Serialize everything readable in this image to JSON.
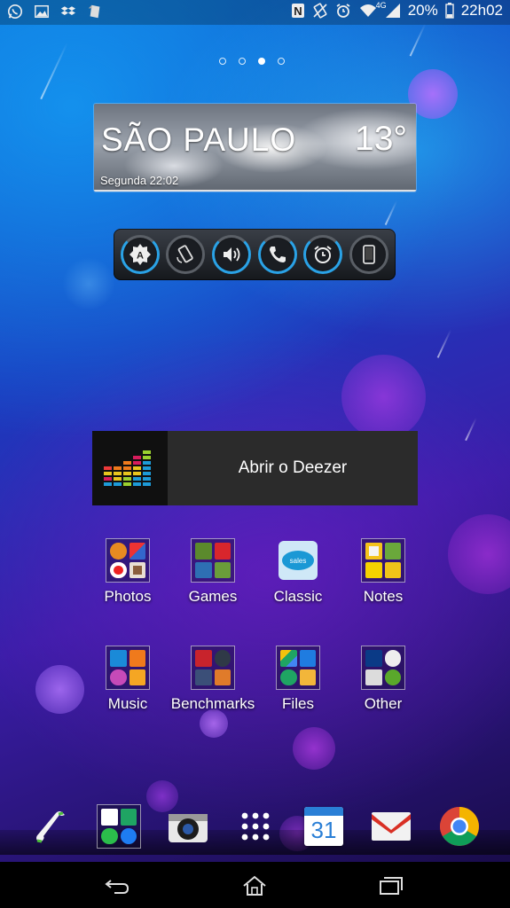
{
  "status_bar": {
    "left_icons": [
      "whatsapp-icon",
      "image-icon",
      "dropbox-icon",
      "evernote-icon"
    ],
    "right_icons": [
      "nfc-icon",
      "vibrate-icon",
      "alarm-icon",
      "wifi-icon",
      "signal-icon",
      "battery-icon"
    ],
    "network_type": "4G",
    "battery_percent": "20%",
    "time": "22h02"
  },
  "home": {
    "pages": 4,
    "active_page": 3
  },
  "weather": {
    "city": "SÃO PAULO",
    "temperature": "13°",
    "datetime": "Segunda 22:02"
  },
  "toggles": [
    {
      "icon": "auto-brightness-icon",
      "on": true
    },
    {
      "icon": "rotate-icon",
      "on": false
    },
    {
      "icon": "sound-icon",
      "on": true
    },
    {
      "icon": "phone-ring-icon",
      "on": true
    },
    {
      "icon": "alarm-clock-icon",
      "on": true
    },
    {
      "icon": "screen-timeout-icon",
      "on": false
    }
  ],
  "deezer": {
    "label": "Abrir o Deezer"
  },
  "folders": [
    {
      "label": "Photos"
    },
    {
      "label": "Games"
    },
    {
      "label": "Classic"
    },
    {
      "label": "Notes"
    },
    {
      "label": "Music"
    },
    {
      "label": "Benchmarks"
    },
    {
      "label": "Files"
    },
    {
      "label": "Other"
    }
  ],
  "dock": {
    "items": [
      "phone-icon",
      "messaging-folder-icon",
      "camera-icon",
      "app-drawer-icon",
      "calendar-icon",
      "gmail-icon",
      "chrome-icon"
    ],
    "calendar_day": "31"
  },
  "colors": {
    "accent": "#2aa2e6",
    "navbar": "#000000"
  }
}
